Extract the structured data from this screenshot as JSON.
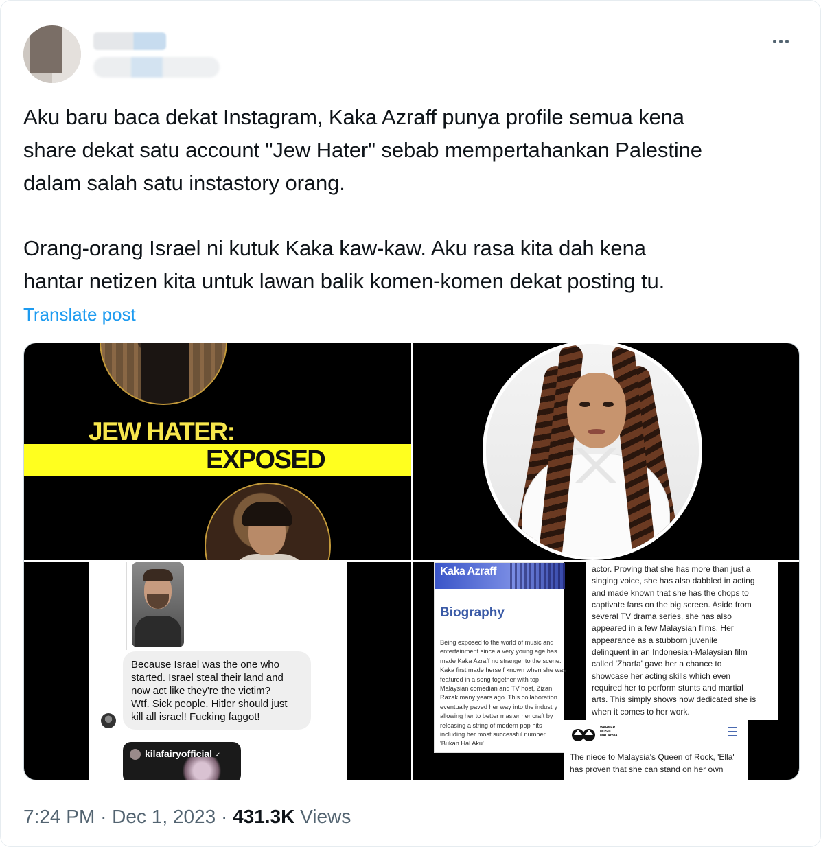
{
  "post": {
    "text_p1": "Aku baru baca dekat Instagram, Kaka Azraff punya profile semua kena\nshare dekat satu account \"Jew Hater\" sebab mempertahankan Palestine\ndalam salah satu instastory orang.",
    "text_p2": "Orang-orang Israel ni kutuk Kaka kaw-kaw. Aku rasa kita dah kena\nhantar netizen kita untuk lawan balik komen-komen dekat posting tu.",
    "translate_label": "Translate post"
  },
  "media": {
    "image1": {
      "line1": "JEW HATER:",
      "line2": "EXPOSED"
    },
    "image3": {
      "comment": "Because Israel was the one who\nstarted. Israel steal their land and\nnow act like they're the victim?\nWtf. Sick people. Hitler should just\nkill all israel! Fucking faggot!",
      "story_user": "kilafairyofficial"
    },
    "image4": {
      "header": "Kaka Azraff",
      "section_title": "Biography",
      "bio_text": "Being exposed to the world of music and\nentertainment since a very young age has\nmade Kaka Azraff no stranger to the scene.\nKaka first made herself known when she was\nfeatured in a song together with top\nMalaysian comedian and TV host, Zizan\nRazak many years ago. This collaboration\neventually paved her way into the industry\nallowing her to better master her craft by\nreleasing a string of modern pop hits\nincluding her most successful number\n'Bukan Hal Aku'.",
      "desc_text": "actor. Proving that she has more than just a\nsinging voice, she has also dabbled in acting\nand made known that she has the chops to\ncaptivate fans on the big screen. Aside from\nseveral TV drama series, she has also\nappeared in a few Malaysian films. Her\nappearance as a stubborn juvenile\ndelinquent in an Indonesian-Malaysian film\ncalled 'Zharfa' gave her a chance to\nshowcase her acting skills which even\nrequired her to perform stunts and martial\narts. This simply shows how dedicated she is\nwhen it comes to her work.",
      "logo_text": "WARNER\nMUSIC\nMALAYSIA",
      "wmg_text": "The niece to Malaysia's Queen of Rock, 'Ella'\nhas proven that she can stand on her own"
    }
  },
  "footer": {
    "time": "7:24 PM",
    "date": "Dec 1, 2023",
    "views_count": "431.3K",
    "views_label": "Views"
  },
  "colors": {
    "link": "#1d9bf0",
    "banner_yellow": "#ffff1f",
    "muted": "#536471"
  },
  "icons": {
    "more": "more-horizontal-icon",
    "verified": "verified-badge-icon",
    "menu": "hamburger-menu-icon"
  }
}
